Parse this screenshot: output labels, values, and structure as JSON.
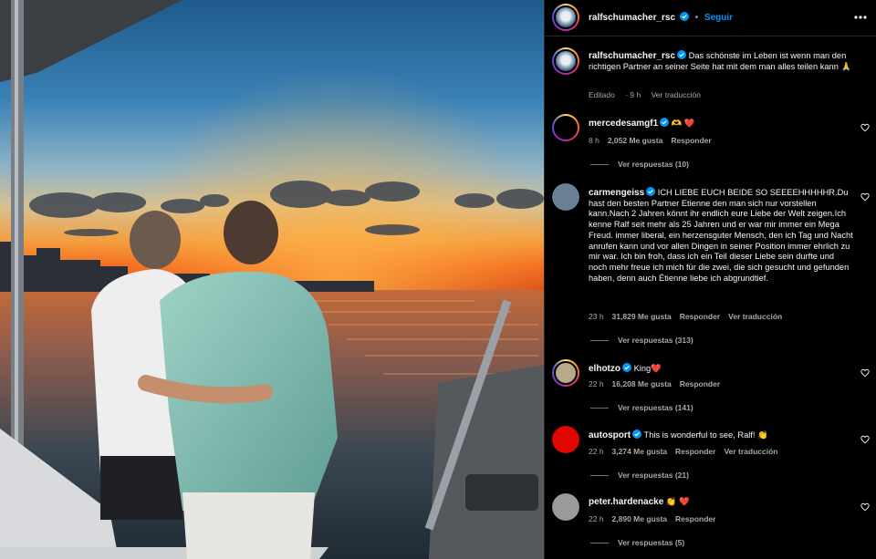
{
  "post": {
    "username": "ralfschumacher_rsc",
    "follow_label": "Seguir",
    "caption": "Das schönste im Leben ist wenn man den richtigen Partner an seiner Seite hat mit dem man alles teilen kann 🙏",
    "edited_label": "Editado",
    "time": "9 h",
    "translate_label": "Ver traducción"
  },
  "comments": [
    {
      "username": "mercedesamgf1",
      "verified": true,
      "text": "🫶 ❤️",
      "time": "8 h",
      "likes": "2,052 Me gusta",
      "reply_label": "Responder",
      "translate": "",
      "replies": "Ver respuestas (10)",
      "avatar_color": "#000000"
    },
    {
      "username": "carmengeiss",
      "verified": true,
      "text": "ICH LIEBE EUCH BEIDE SO SEEEEHHHHHR.Du hast den besten Partner Etienne den man sich nur vorstellen kann.Nach 2 Jahren könnt ihr endlich eure Liebe der Welt zeigen.Ich kenne Ralf seit mehr als 25 Jahren und er war mir immer ein Mega Freud. immer liberal, ein herzensguter Mensch, den ich Tag und Nacht anrufen kann und vor allen Dingen in seiner Position immer ehrlich zu mir war. Ich bin froh, dass ich ein Teil dieser Liebe sein durfte und noch mehr freue ich mich für die zwei, die sich gesucht und gefunden haben, denn auch Étienne liebe ich abgrundtief.",
      "time": "23 h",
      "likes": "31,829 Me gusta",
      "reply_label": "Responder",
      "translate": "Ver traducción",
      "replies": "Ver respuestas (313)",
      "avatar_color": "#6a7f95"
    },
    {
      "username": "elhotzo",
      "verified": true,
      "text": "King❤️",
      "time": "22 h",
      "likes": "16,208 Me gusta",
      "reply_label": "Responder",
      "translate": "",
      "replies": "Ver respuestas (141)",
      "avatar_color": "#b8a98a"
    },
    {
      "username": "autosport",
      "verified": true,
      "text": "This is wonderful to see, Ralf! 👏",
      "time": "22 h",
      "likes": "3,274 Me gusta",
      "reply_label": "Responder",
      "translate": "Ver traducción",
      "replies": "Ver respuestas (21)",
      "avatar_color": "#e10600"
    },
    {
      "username": "peter.hardenacke",
      "verified": false,
      "text": "👏 ❤️",
      "time": "22 h",
      "likes": "2,890 Me gusta",
      "reply_label": "Responder",
      "translate": "",
      "replies": "Ver respuestas (5)",
      "avatar_color": "#9a9a9a"
    }
  ],
  "icons": {
    "verified": "verified-badge-icon",
    "like": "heart-icon",
    "more": "more-options-icon"
  },
  "colors": {
    "accent": "#0095f6",
    "verified": "#0095f6",
    "background": "#000000",
    "secondary_text": "#a8a8a8"
  }
}
